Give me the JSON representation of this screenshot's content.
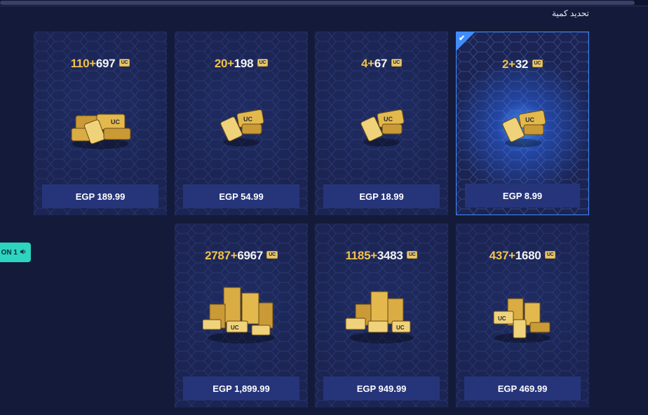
{
  "section_title": "تحديد كمية",
  "side_tab": {
    "label": "ON 1",
    "icon": "speaker-icon"
  },
  "uc_badge": "UC",
  "currency_color": "#f2c14b",
  "packs": [
    {
      "base": "110",
      "bonus": "697",
      "plus": "+",
      "price": "EGP 189.99",
      "selected": false
    },
    {
      "base": "20",
      "bonus": "198",
      "plus": "+",
      "price": "EGP 54.99",
      "selected": false
    },
    {
      "base": "4",
      "bonus": "67",
      "plus": "+",
      "price": "EGP 18.99",
      "selected": false
    },
    {
      "base": "2",
      "bonus": "32",
      "plus": "+",
      "price": "EGP 8.99",
      "selected": true
    },
    {
      "base": "2787",
      "bonus": "6967",
      "plus": "+",
      "price": "EGP 1,899.99",
      "selected": false
    },
    {
      "base": "1185",
      "bonus": "3483",
      "plus": "+",
      "price": "EGP 949.99",
      "selected": false
    },
    {
      "base": "437",
      "bonus": "1680",
      "plus": "+",
      "price": "EGP 469.99",
      "selected": false
    }
  ]
}
